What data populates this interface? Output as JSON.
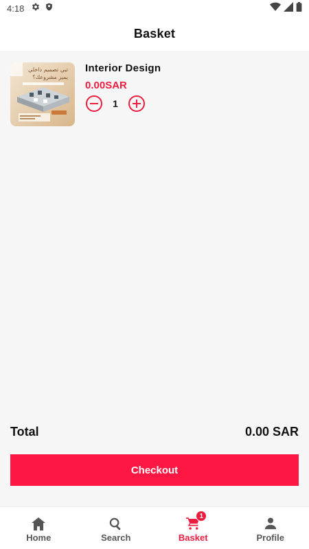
{
  "status_bar": {
    "time": "4:18",
    "left_icons": [
      "gear-icon",
      "shield-icon"
    ],
    "right_icons": [
      "wifi-icon",
      "signal-icon",
      "battery-icon"
    ]
  },
  "header": {
    "title": "Basket"
  },
  "basket": {
    "items": [
      {
        "name": "Interior Design",
        "price": "0.00SAR",
        "quantity": "1",
        "image": {
          "heading_line1": "تبي تصميم داخلي",
          "heading_line2": "يميز مشروعك؟"
        }
      }
    ],
    "total_label": "Total",
    "total_value": "0.00 SAR",
    "checkout_label": "Checkout"
  },
  "bottom_nav": {
    "items": [
      {
        "label": "Home",
        "icon": "home-icon",
        "active": false
      },
      {
        "label": "Search",
        "icon": "search-icon",
        "active": false
      },
      {
        "label": "Basket",
        "icon": "cart-icon",
        "active": true,
        "badge": "1"
      },
      {
        "label": "Profile",
        "icon": "person-icon",
        "active": false
      }
    ]
  },
  "colors": {
    "accent": "#ec1c3f",
    "checkout_button": "#ff1744",
    "background": "#f6f6f6",
    "surface": "#ffffff"
  }
}
